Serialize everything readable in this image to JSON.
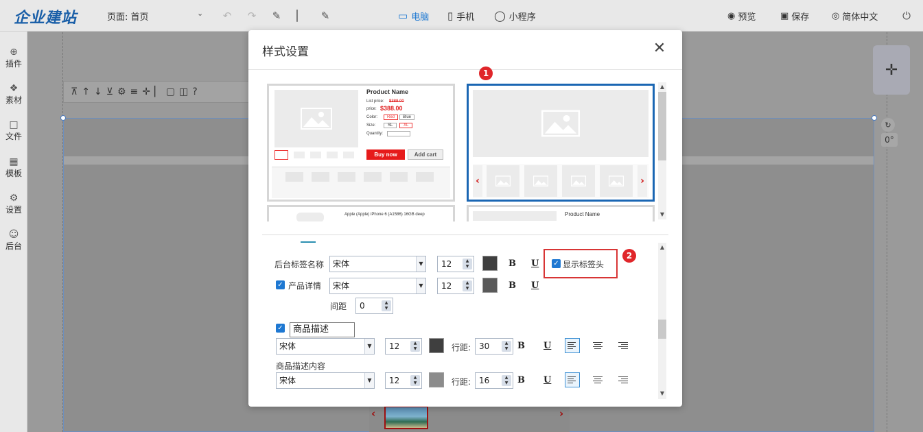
{
  "app": {
    "logo": "企业建站",
    "page_label": "页面: 首页",
    "devices": [
      {
        "label": "电脑",
        "active": true
      },
      {
        "label": "手机",
        "active": false
      },
      {
        "label": "小程序",
        "active": false
      }
    ],
    "actions": {
      "preview": "预览",
      "save": "保存",
      "language": "简体中文"
    }
  },
  "sidebar": {
    "items": [
      {
        "label": "插件",
        "icon": "plus-circle-icon"
      },
      {
        "label": "素材",
        "icon": "shapes-icon"
      },
      {
        "label": "文件",
        "icon": "folder-icon"
      },
      {
        "label": "模板",
        "icon": "grid-icon"
      },
      {
        "label": "设置",
        "icon": "gear-icon"
      },
      {
        "label": "后台",
        "icon": "user-icon"
      }
    ]
  },
  "canvas": {
    "rotation": "0°"
  },
  "modal": {
    "title": "样式设置",
    "templates": [
      {
        "product_name": "Product Name",
        "list_price_label": "List price:",
        "list_price": "$388.00",
        "price_label": "price:",
        "price": "$388.00",
        "color_label": "Color:",
        "colors": [
          "Red",
          "Blue"
        ],
        "size_label": "Size:",
        "sizes": [
          "SL",
          "XL"
        ],
        "quantity_label": "Quantity:",
        "buy_label": "Buy now",
        "cart_label": "Add cart"
      },
      {
        "selected": true
      },
      {
        "caption": "Apple (Apple) iPhone 6 (A1586) 16GB deep"
      },
      {
        "product_name": "Product Name"
      }
    ],
    "badges": [
      "1",
      "2"
    ],
    "settings": {
      "tag_name_label": "后台标签名称",
      "tag_font": "宋体",
      "tag_size": "12",
      "show_tag_head_label": "显示标签头",
      "detail_label": "产品详情",
      "detail_font": "宋体",
      "detail_size": "12",
      "spacing_label": "间距",
      "spacing_value": "0",
      "desc_title_value": "商品描述",
      "desc_font": "宋体",
      "desc_size": "12",
      "line_height_label": "行距:",
      "desc_line_height": "30",
      "desc_content_label": "商品描述内容",
      "content_font": "宋体",
      "content_size": "12",
      "content_line_height": "16",
      "bold_label": "B",
      "underline_label": "U"
    },
    "colors": {
      "dark_swatch": "#3f3f3f",
      "mid_swatch": "#595959",
      "light_swatch": "#8c8c8c",
      "accent": "#1a66b3",
      "highlight": "#d83535"
    }
  }
}
